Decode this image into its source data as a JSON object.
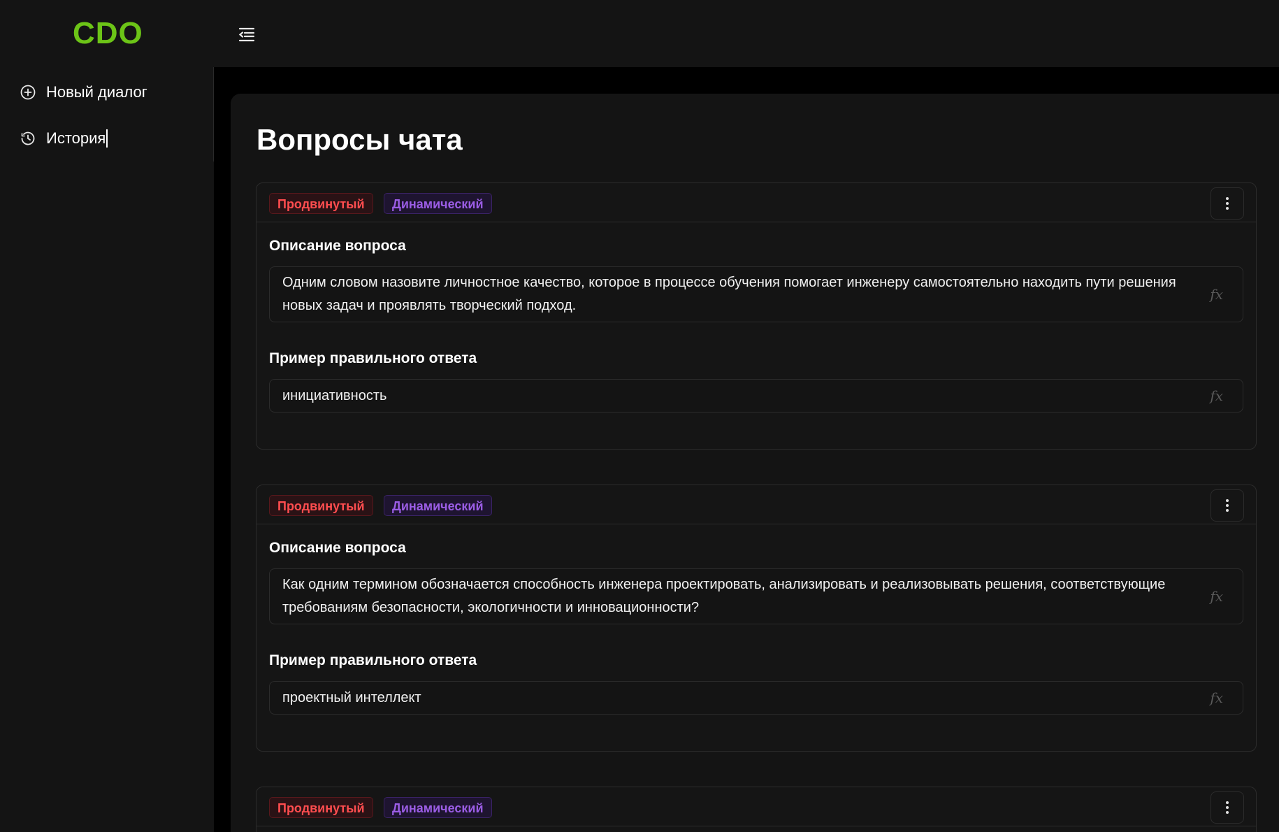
{
  "header": {
    "logo": "CDO"
  },
  "sidebar": {
    "items": [
      {
        "label": "Новый диалог",
        "icon": "plus-circle-icon"
      },
      {
        "label": "История",
        "icon": "clock-icon"
      }
    ]
  },
  "main": {
    "title": "Вопросы чата",
    "cards": [
      {
        "level_tag": "Продвинутый",
        "kind_tag": "Динамический",
        "question_label": "Описание вопроса",
        "question": "Одним словом назовите личностное качество, которое в процессе обучения помогает инженеру самостоятельно находить пути решения новых задач и проявлять творческий подход.",
        "answer_label": "Пример правильного ответа",
        "answer": "инициативность",
        "fx": "fx"
      },
      {
        "level_tag": "Продвинутый",
        "kind_tag": "Динамический",
        "question_label": "Описание вопроса",
        "question": "Как одним термином обозначается способность инженера проектировать, анализировать и реализовывать решения, соответствующие требованиям безопасности, экологичности и инновационности?",
        "answer_label": "Пример правильного ответа",
        "answer": "проектный интеллект",
        "fx": "fx"
      },
      {
        "level_tag": "Продвинутый",
        "kind_tag": "Динамический"
      }
    ]
  },
  "colors": {
    "accent": "#6cc417",
    "level_tag": "#ff4d4f",
    "kind_tag": "#9b5de5"
  }
}
